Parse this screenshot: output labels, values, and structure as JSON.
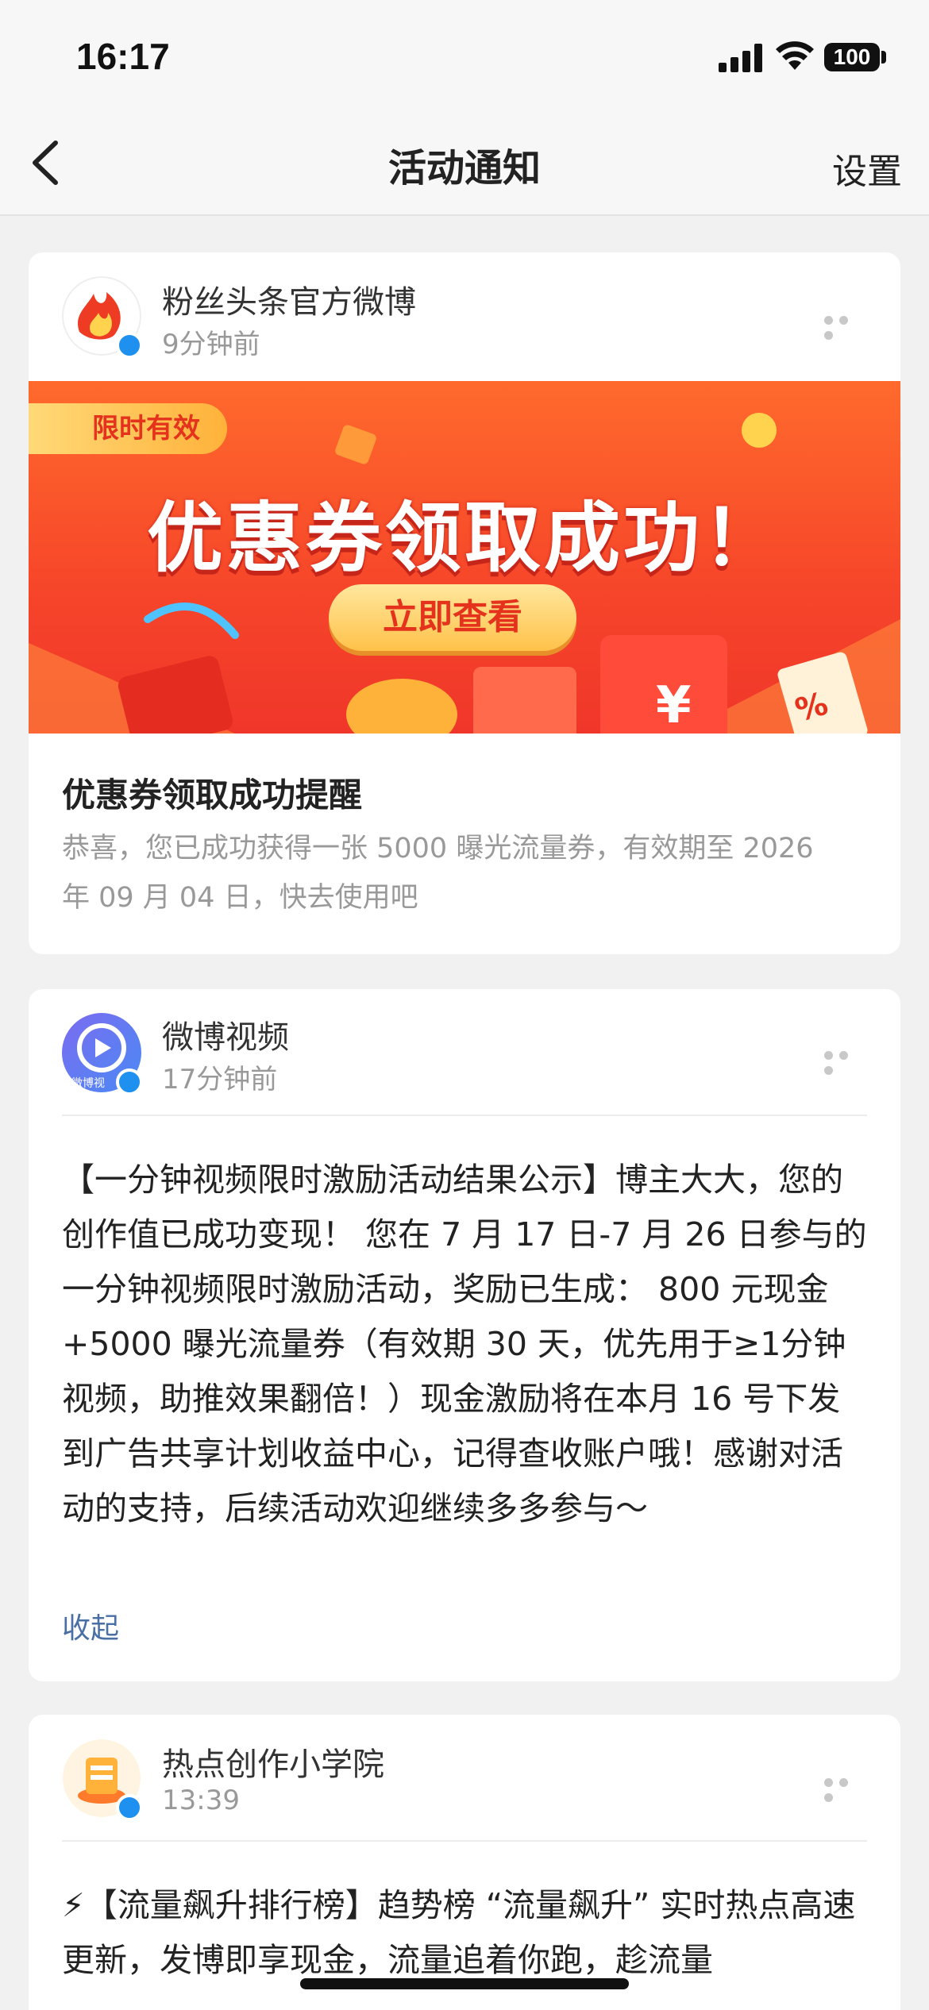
{
  "status_bar": {
    "time": "16:17",
    "battery": "100"
  },
  "nav": {
    "title": "活动通知",
    "settings_label": "设置"
  },
  "notifications": [
    {
      "poster": "粉丝头条官方微博",
      "time": "9分钟前",
      "banner": {
        "badge": "限时有效",
        "headline": "优惠券领取成功！",
        "cta": "立即查看"
      },
      "title": "优惠券领取成功提醒",
      "body": "恭喜，您已成功获得一张 5000 曝光流量券，有效期至 2026 年 09 月 04 日，快去使用吧"
    },
    {
      "poster": "微博视频",
      "time": "17分钟前",
      "avatar_caption": "微博视",
      "text": "【一分钟视频限时激励活动结果公示】博主大大，您的创作值已成功变现！ 您在 7 月 17 日-7 月 26 日参与的一分钟视频限时激励活动，奖励已生成： 800 元现金 +5000 曝光流量券（有效期 30 天，优先用于≥1分钟视频，助推效果翻倍！）现金激励将在本月 16 号下发到广告共享计划收益中心，记得查收账户哦！感谢对活动的支持，后续活动欢迎继续多多参与～",
      "collapse_label": "收起"
    },
    {
      "poster": "热点创作小学院",
      "time": "13:39",
      "text": "⚡【流量飙升排行榜】趋势榜 “流量飙升” 实时热点高速更新，发博即享现金，流量追着你跑，趁流量"
    }
  ],
  "colors": {
    "accent_blue": "#1e90f0",
    "link_blue": "#4a6fa5",
    "banner_red": "#f6452a",
    "cta_gold": "#ffc24a"
  }
}
